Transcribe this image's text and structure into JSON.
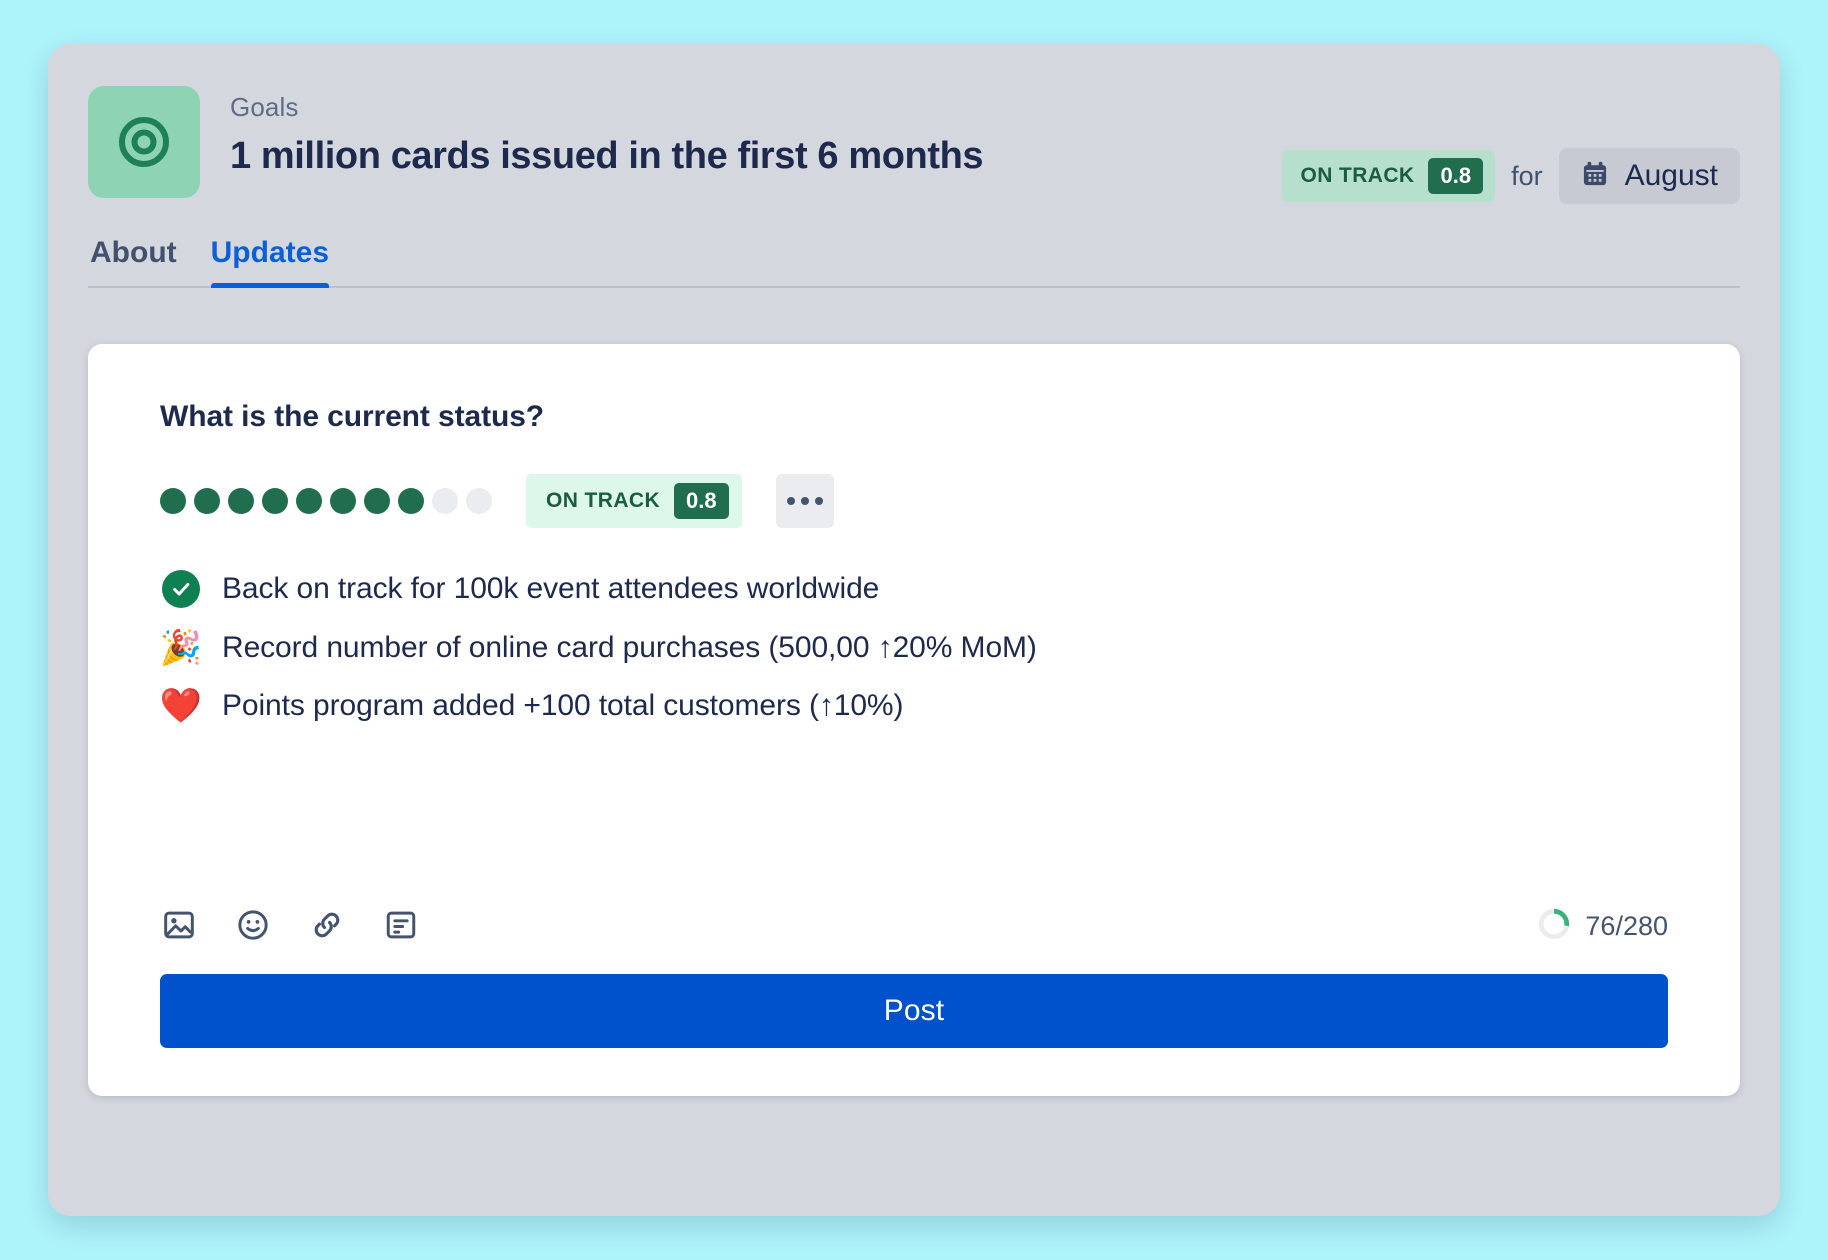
{
  "header": {
    "eyebrow": "Goals",
    "title": "1 million cards issued in the first 6 months",
    "goal_icon": "target-icon",
    "status": {
      "label": "ON TRACK",
      "score": "0.8"
    },
    "for_label": "for",
    "period": {
      "icon": "calendar-icon",
      "label": "August"
    }
  },
  "tabs": [
    {
      "id": "about",
      "label": "About",
      "active": false
    },
    {
      "id": "updates",
      "label": "Updates",
      "active": true
    }
  ],
  "composer": {
    "heading": "What is the current status?",
    "progress_dots": {
      "total": 10,
      "filled": 8
    },
    "status": {
      "label": "ON TRACK",
      "score": "0.8"
    },
    "more_button": "more-options-icon",
    "bullets": [
      {
        "glyph": "check-mark-button",
        "text": "Back on track for 100k event attendees worldwide"
      },
      {
        "glyph": "party-popper",
        "text": "Record number of online card purchases (500,00 ↑20% MoM)"
      },
      {
        "glyph": "red-heart",
        "text": "Points program added +100 total customers (↑10%)"
      }
    ],
    "toolbar_icons": [
      {
        "name": "image-icon",
        "label": "Insert image"
      },
      {
        "name": "emoji-icon",
        "label": "Insert emoji"
      },
      {
        "name": "link-icon",
        "label": "Insert link"
      },
      {
        "name": "document-icon",
        "label": "Insert document"
      }
    ],
    "counter": {
      "text": "76/280",
      "used": 76,
      "limit": 280
    },
    "post_label": "Post"
  },
  "colors": {
    "page_background": "#ADF3FA",
    "panel_background": "#D4D7DE",
    "accent_blue": "#0052CC",
    "tab_active": "#0B5FD9",
    "status_green": "#216E4E",
    "status_green_light": "#DDF7EA",
    "status_green_header": "#B7DFCE",
    "goal_tile_green": "#8FD3B5",
    "text_dark": "#1D2A4D",
    "text_muted": "#5E6C84",
    "dot_empty": "#EBECF0"
  }
}
